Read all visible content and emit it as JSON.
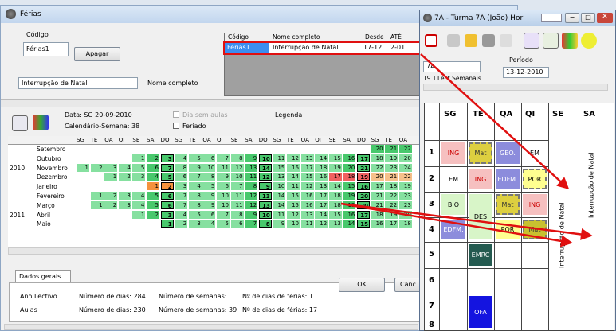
{
  "main": {
    "title": "Férias",
    "codigo_label": "Código",
    "codigo_value": "Férias1",
    "apagar": "Apagar",
    "desc_value": "Interrupção de Natal",
    "nome_label": "Nome completo",
    "list_headers": [
      "Código",
      "Nome completo",
      "Desde",
      "ATÉ"
    ],
    "list_row": [
      "Férias1",
      "Interrupção de Natal",
      "17-12",
      "2-01"
    ],
    "data_text": "Data: SG 20-09-2010",
    "semana_text": "Calendário-Semana: 38",
    "dia_sem_aulas": "Dia sem aulas",
    "feriado": "Feriado",
    "legenda": "Legenda",
    "day_headers": [
      "SG",
      "TE",
      "QA",
      "QI",
      "SE",
      "SA",
      "DO",
      "SG",
      "TE",
      "QA",
      "QI",
      "SE",
      "SA",
      "DO",
      "SG",
      "TE",
      "QA",
      "QI",
      "SE",
      "SA",
      "DO",
      "SG",
      "TE",
      "QA"
    ],
    "years": [
      "2010",
      "2011"
    ],
    "months": [
      "Setembro",
      "Outubro",
      "Novembro",
      "Dezembro",
      "Janeiro",
      "Fevereiro",
      "Março",
      "Abril",
      "Maio"
    ],
    "tab": "Dados gerais",
    "ok": "OK",
    "cancel": "Canc",
    "row1": [
      "Ano Lectivo",
      "Número de dias: 284",
      "Número de semanas:",
      "Nº de dias de férias: 1"
    ],
    "row2": [
      "Aulas",
      "Número de dias: 230",
      "Número de semanas: 39",
      "Nº de dias de férias: 17"
    ]
  },
  "tt": {
    "title": "7A - Turma 7A (João)  Hor",
    "class_sel": "7A",
    "info1": "19  T.Lect.Semanais",
    "periodo_label": "Período",
    "date_value": "13-12-2010",
    "days": [
      "SG",
      "TE",
      "QA",
      "QI",
      "SE",
      "SA"
    ],
    "periods": [
      "1",
      "2",
      "3",
      "4",
      "5",
      "6",
      "7",
      "8"
    ],
    "lessons": [
      "ING",
      "Mat",
      "GEO.",
      "EM",
      "EM",
      "ING",
      "EDFM.",
      "POR",
      "BIO",
      "DES",
      "Mat",
      "ING",
      "EDFM.",
      "POR",
      "Mat",
      "EMRC",
      "OFA"
    ],
    "holiday": "Interrupção de Natal",
    "colors": {
      "pink": "#f6c0c0",
      "lightgreen": "#d8f5c8",
      "blue": "#8c8cdc",
      "yellow": "#ffff90",
      "teal": "#245a50",
      "navy": "#1414e0",
      "accent": "#e01010"
    }
  }
}
